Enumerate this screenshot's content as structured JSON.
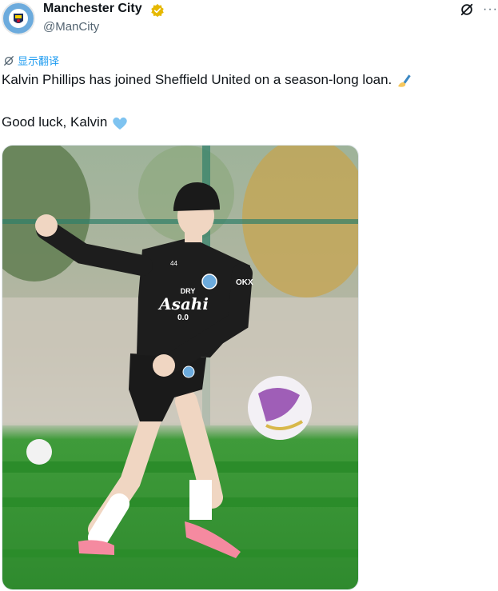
{
  "author": {
    "display_name": "Manchester City",
    "handle": "@ManCity",
    "avatar_text": "MANCHESTER CITY"
  },
  "translate_label": "显示翻译",
  "tweet": {
    "line1": "Kalvin Phillips has joined Sheffield United on a season-long loan.",
    "line2": "Good luck, Kalvin"
  },
  "jersey": {
    "sponsor_top": "DRY",
    "sponsor_main": "Asahi",
    "sponsor_sub": "0.0",
    "number": "44",
    "sleeve": "OKX"
  },
  "icons": {
    "verified": "verified-badge-icon",
    "grok": "grok-icon",
    "more": "more-options-icon",
    "translate": "translate-icon",
    "writing": "writing-hand-emoji",
    "heart": "light-blue-heart-emoji"
  },
  "colors": {
    "link": "#1d9bf0",
    "text": "#0f1419",
    "secondary": "#536471",
    "badge": "#e6b800",
    "heart": "#7ec3f0",
    "pitch": "#3f9b3a"
  }
}
